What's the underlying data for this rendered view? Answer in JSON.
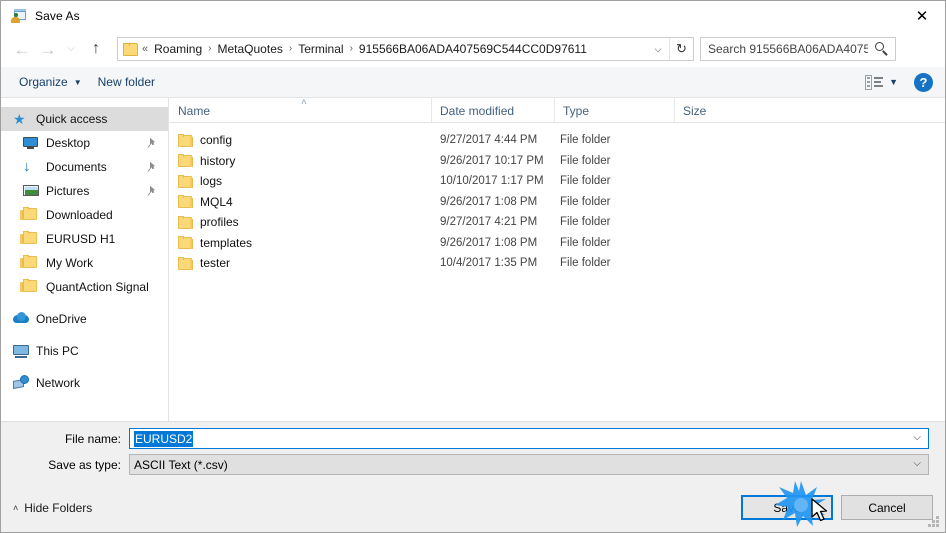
{
  "window": {
    "title": "Save As",
    "icon": "save-as-icon",
    "close_label": "✕"
  },
  "nav": {
    "back_icon": "←",
    "forward_icon": "→",
    "recent_icon": "⌵",
    "up_icon": "↑",
    "breadcrumbs": [
      "Roaming",
      "MetaQuotes",
      "Terminal",
      "915566BA06ADA407569C544CC0D97611"
    ],
    "separator": "›",
    "lead_separator": "«",
    "dropdown_icon": "⌵",
    "refresh_icon": "↻"
  },
  "search": {
    "placeholder": "Search 915566BA06ADA40756...",
    "icon": "search-icon"
  },
  "toolbar": {
    "organize_label": "Organize",
    "organize_caret": "▼",
    "new_folder_label": "New folder",
    "view_caret": "▼",
    "help_label": "?"
  },
  "sidebar": {
    "items": [
      {
        "label": "Quick access",
        "icon": "star-icon",
        "selected": true,
        "pinned": false,
        "indent": "root"
      },
      {
        "label": "Desktop",
        "icon": "monitor-icon",
        "selected": false,
        "pinned": true,
        "indent": "child"
      },
      {
        "label": "Documents",
        "icon": "download-arrow-icon",
        "selected": false,
        "pinned": true,
        "indent": "child"
      },
      {
        "label": "Pictures",
        "icon": "picture-icon",
        "selected": false,
        "pinned": true,
        "indent": "child"
      },
      {
        "label": "Downloaded",
        "icon": "folder-icon",
        "selected": false,
        "pinned": false,
        "indent": "child"
      },
      {
        "label": "EURUSD H1",
        "icon": "folder-icon",
        "selected": false,
        "pinned": false,
        "indent": "child"
      },
      {
        "label": "My Work",
        "icon": "folder-icon",
        "selected": false,
        "pinned": false,
        "indent": "child"
      },
      {
        "label": "QuantAction Signal",
        "icon": "folder-icon",
        "selected": false,
        "pinned": false,
        "indent": "child"
      },
      {
        "label": "OneDrive",
        "icon": "cloud-icon",
        "selected": false,
        "pinned": false,
        "indent": "root"
      },
      {
        "label": "This PC",
        "icon": "computer-icon",
        "selected": false,
        "pinned": false,
        "indent": "root"
      },
      {
        "label": "Network",
        "icon": "network-icon",
        "selected": false,
        "pinned": false,
        "indent": "root"
      }
    ],
    "pin_icon": "📌"
  },
  "filelist": {
    "columns": [
      "Name",
      "Date modified",
      "Type",
      "Size"
    ],
    "sort_caret": "˄",
    "rows": [
      {
        "name": "config",
        "date": "9/27/2017 4:44 PM",
        "type": "File folder",
        "size": ""
      },
      {
        "name": "history",
        "date": "9/26/2017 10:17 PM",
        "type": "File folder",
        "size": ""
      },
      {
        "name": "logs",
        "date": "10/10/2017 1:17 PM",
        "type": "File folder",
        "size": ""
      },
      {
        "name": "MQL4",
        "date": "9/26/2017 1:08 PM",
        "type": "File folder",
        "size": ""
      },
      {
        "name": "profiles",
        "date": "9/27/2017 4:21 PM",
        "type": "File folder",
        "size": ""
      },
      {
        "name": "templates",
        "date": "9/26/2017 1:08 PM",
        "type": "File folder",
        "size": ""
      },
      {
        "name": "tester",
        "date": "10/4/2017 1:35 PM",
        "type": "File folder",
        "size": ""
      }
    ]
  },
  "form": {
    "filename_label": "File name:",
    "filename_value": "EURUSD2",
    "filetype_label": "Save as type:",
    "filetype_value": "ASCII Text (*.csv)",
    "caret_icon": "⌵"
  },
  "footer": {
    "hide_folders_label": "Hide Folders",
    "hide_folders_caret": "˄",
    "save_label": "Save",
    "cancel_label": "Cancel"
  },
  "colors": {
    "accent": "#0078d7",
    "folder": "#fcd978",
    "selection": "#0078d7",
    "header_text": "#44617f",
    "toolbar_text": "#17406b"
  }
}
